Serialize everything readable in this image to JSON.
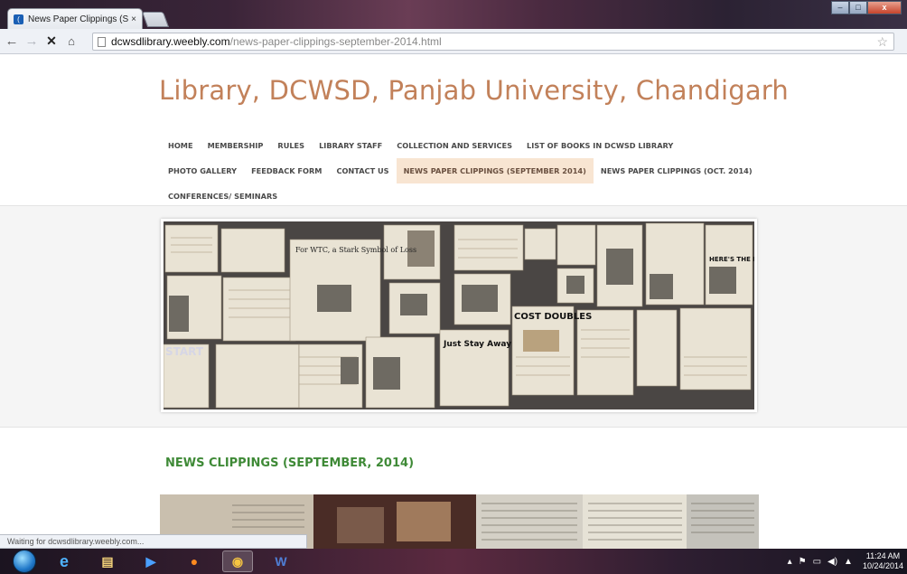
{
  "browser": {
    "tab_title": "News Paper Clippings (Se",
    "tab_close": "×",
    "url_host": "dcwsdlibrary.weebly.com",
    "url_path": "/news-paper-clippings-september-2014.html",
    "status_text": "Waiting for dcwsdlibrary.weebly.com...",
    "window_buttons": {
      "minimize": "–",
      "maximize": "□",
      "close": "x"
    }
  },
  "site": {
    "title": "Library, DCWSD, Panjab University, Chandigarh",
    "nav": {
      "row1": [
        "HOME",
        "MEMBERSHIP",
        "RULES",
        "LIBRARY STAFF",
        "COLLECTION AND SERVICES",
        "LIST OF BOOKS IN DCWSD LIBRARY"
      ],
      "row2": [
        "PHOTO GALLERY",
        "FEEDBACK FORM",
        "CONTACT US",
        "NEWS PAPER CLIPPINGS (SEPTEMBER 2014)",
        "NEWS PAPER CLIPPINGS (OCT. 2014)"
      ],
      "row3": [
        "CONFERENCES/ SEMINARS"
      ],
      "active": "NEWS PAPER CLIPPINGS (SEPTEMBER 2014)"
    },
    "banner_headlines": {
      "h1": "For WTC, a Stark Symbol of Loss",
      "h2": "COST DOUBLES",
      "h3": "Just Stay Away",
      "h4": "HERE'S THE PLAN",
      "h5": "START"
    },
    "section_heading": "NEWS CLIPPINGS (SEPTEMBER, 2014)"
  },
  "taskbar": {
    "time": "11:24 AM",
    "date": "10/24/2014"
  },
  "colors": {
    "title": "#c2815a",
    "heading": "#3f8a37",
    "nav_active_bg": "#f8e5d2"
  }
}
